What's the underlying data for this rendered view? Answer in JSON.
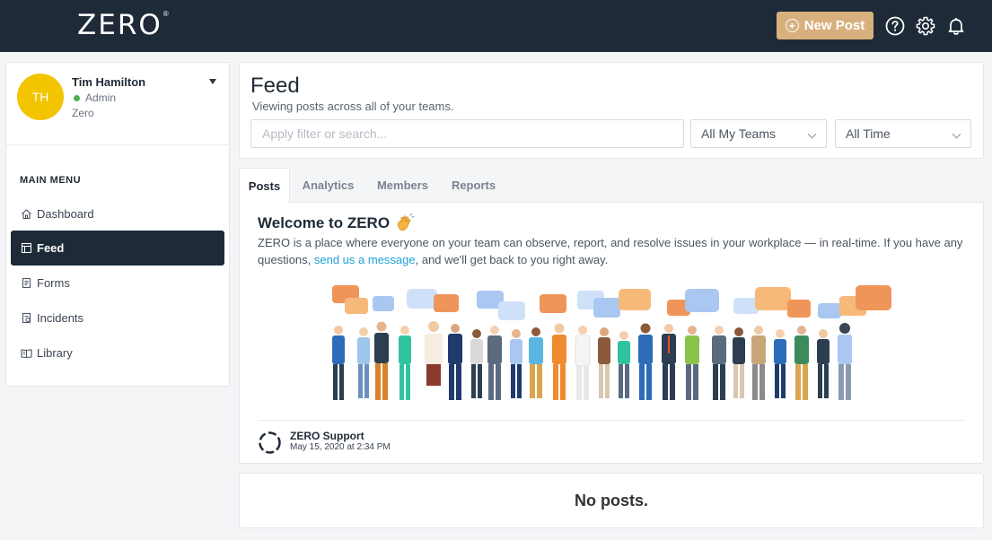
{
  "brand": {
    "logo_text": "ZERO",
    "registered_mark": "®"
  },
  "topbar": {
    "new_post_label": "New Post",
    "icons": [
      "help-icon",
      "gear-icon",
      "bell-icon"
    ],
    "colors": {
      "bar": "#1e2a38",
      "new_post": "#d8b07e"
    }
  },
  "profile": {
    "initials": "TH",
    "name": "Tim Hamilton",
    "role": "Admin",
    "org": "Zero",
    "avatar_color": "#f2c500",
    "status_color": "#4caf50"
  },
  "sidebar": {
    "menu_title": "MAIN MENU",
    "items": [
      {
        "label": "Dashboard",
        "icon": "home-icon",
        "active": false
      },
      {
        "label": "Feed",
        "icon": "feed-icon",
        "active": true
      },
      {
        "label": "Forms",
        "icon": "form-icon",
        "active": false
      },
      {
        "label": "Incidents",
        "icon": "incident-icon",
        "active": false
      },
      {
        "label": "Library",
        "icon": "book-icon",
        "active": false
      }
    ]
  },
  "feed": {
    "title": "Feed",
    "subtitle": "Viewing posts across all of your teams.",
    "search_placeholder": "Apply filter or search...",
    "team_filter": "All My Teams",
    "time_filter": "All Time"
  },
  "tabs": [
    {
      "label": "Posts",
      "active": true
    },
    {
      "label": "Analytics",
      "active": false
    },
    {
      "label": "Members",
      "active": false
    },
    {
      "label": "Reports",
      "active": false
    }
  ],
  "post": {
    "title": "Welcome to ZERO",
    "title_emoji": "waving-hand-icon",
    "body_before_link": "ZERO is a place where everyone on your team can observe, report, and resolve issues in your workplace — in real-time. If you have any questions, ",
    "link_text": "send us a message",
    "body_after_link": ", and we'll get back to you right away.",
    "author": "ZERO Support",
    "date": "May 15, 2020 at 2:34 PM",
    "link_color": "#1ea1d6"
  },
  "empty_state": {
    "message": "No posts."
  }
}
